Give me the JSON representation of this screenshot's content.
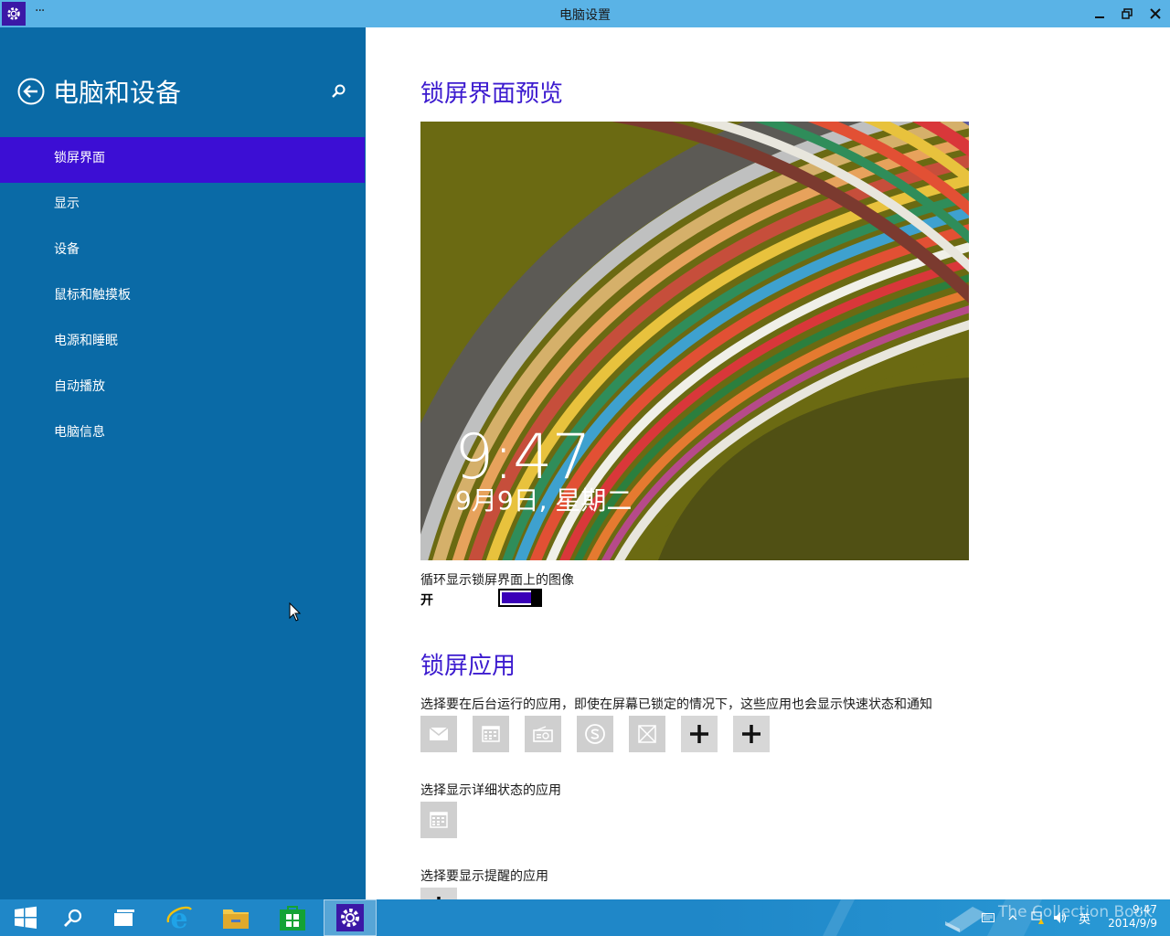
{
  "window": {
    "title": "电脑设置",
    "menu_dots": "···"
  },
  "sidebar": {
    "title": "电脑和设备",
    "items": [
      {
        "label": "锁屏界面",
        "active": true
      },
      {
        "label": "显示"
      },
      {
        "label": "设备"
      },
      {
        "label": "鼠标和触摸板"
      },
      {
        "label": "电源和睡眠"
      },
      {
        "label": "自动播放"
      },
      {
        "label": "电脑信息"
      }
    ]
  },
  "main": {
    "preview_heading": "锁屏界面预览",
    "preview": {
      "time": "9:47",
      "date": "9月9日, 星期二"
    },
    "slideshow_label": "循环显示锁屏界面上的图像",
    "slideshow_state": "开",
    "apps_heading": "锁屏应用",
    "apps_desc": "选择要在后台运行的应用，即使在屏幕已锁定的情况下，这些应用也会显示快速状态和通知",
    "quick_apps": [
      "mail-icon",
      "calendar-icon",
      "radio-icon",
      "skype-icon",
      "blocked-icon",
      "plus-icon",
      "plus-icon"
    ],
    "detail_label": "选择显示详细状态的应用",
    "detail_app": "calendar-icon",
    "alarm_label": "选择要显示提醒的应用"
  },
  "taskbar": {
    "watermark": "The Collection Book",
    "tray_ime": "英",
    "time": "9:47",
    "date": "2014/9/9"
  },
  "colors": {
    "accent": "#3c1bcf",
    "sidebar": "#0a6aa6",
    "active_item": "#3c0ed4",
    "titlebar": "#5ab3e6",
    "taskbar": "#1f87c8"
  }
}
